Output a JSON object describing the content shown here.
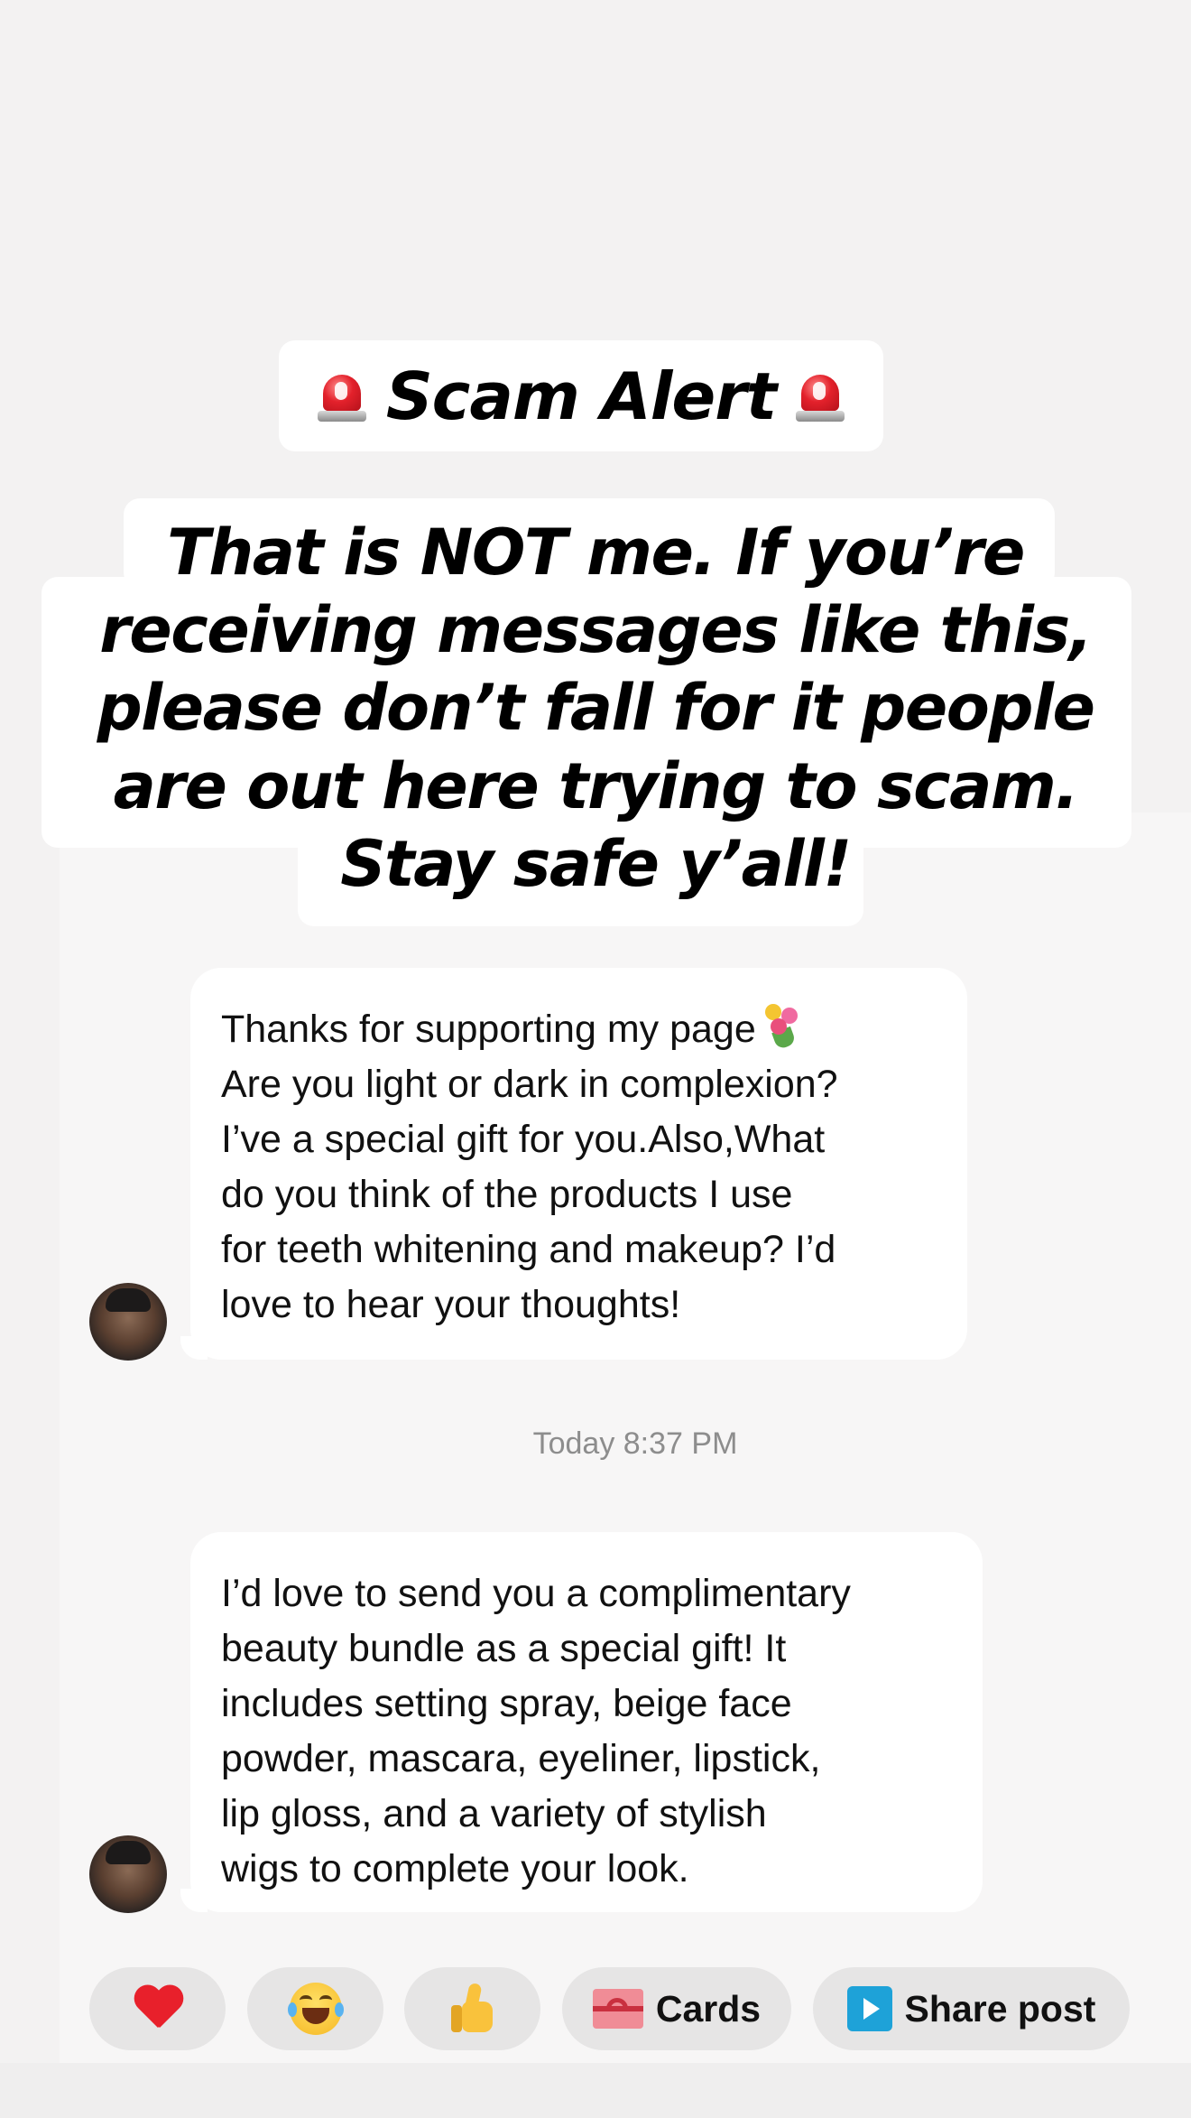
{
  "story": {
    "alert_title": "Scam Alert",
    "message_lines": [
      "That is NOT me. If you’re",
      "receiving messages like this,",
      "please don’t fall for it people",
      "are out here trying to scam.",
      "Stay safe y’all!"
    ]
  },
  "chat": {
    "messages": [
      {
        "lines": [
          "Thanks for supporting my page",
          "Are you light or dark in complexion?",
          "I’ve a special gift for you.Also,What",
          "do you think of the products I use",
          "for teeth whitening and makeup? I’d",
          "love to hear your thoughts!"
        ]
      },
      {
        "lines": [
          "I’d love to send you a complimentary",
          "beauty bundle as a special gift! It",
          "includes setting spray, beige face",
          "powder, mascara, eyeliner, lipstick,",
          "lip gloss, and a variety of stylish",
          "wigs to complete your look."
        ]
      }
    ],
    "timestamp": "Today 8:37 PM"
  },
  "reactions": {
    "heart": "heart-icon",
    "laugh": "laughing-tears-icon",
    "thumbs": "thumbs-up-icon",
    "cards_label": "Cards",
    "share_label": "Share post"
  },
  "colors": {
    "background": "#f3f2f2",
    "bubble": "#ffffff",
    "reaction_button": "#e6e5e5",
    "timestamp": "#8d8d8d",
    "siren_red": "#e3212b",
    "share_icon": "#1ea2d8"
  }
}
